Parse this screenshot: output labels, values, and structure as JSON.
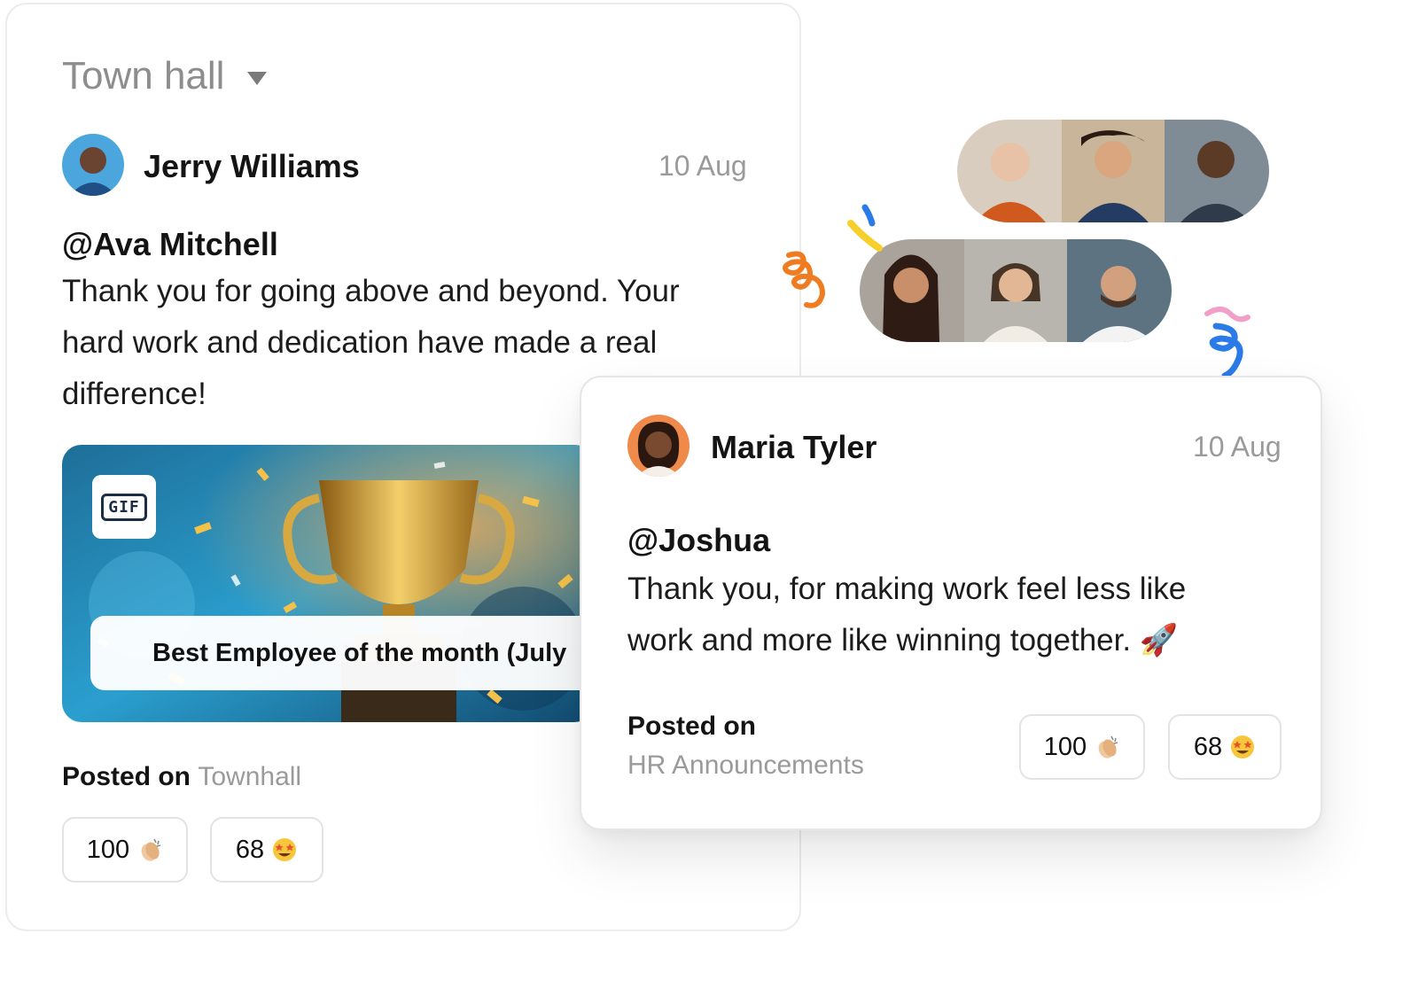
{
  "channel": {
    "name": "Town hall"
  },
  "post_a": {
    "author": "Jerry Williams",
    "date": "10 Aug",
    "mention": "@Ava Mitchell",
    "message_lines": [
      "Thank you for going above and beyond. Your",
      "hard work and dedication have made a real",
      "difference!"
    ],
    "gif_badge": "GIF",
    "banner": "Best Employee of the month (July",
    "posted_on_label": "Posted on",
    "posted_on_channel": "Townhall",
    "reactions": [
      {
        "count": "100",
        "icon": "clapping-hands-icon"
      },
      {
        "count": "68",
        "icon": "star-struck-face-icon"
      }
    ]
  },
  "post_b": {
    "author": "Maria Tyler",
    "date": "10 Aug",
    "mention": "@Joshua",
    "message_lines": [
      "Thank you, for making work feel less like",
      "work and more like winning together. 🚀"
    ],
    "posted_on_label": "Posted on",
    "posted_on_channel": "HR Announcements",
    "reactions": [
      {
        "count": "100",
        "icon": "clapping-hands-icon"
      },
      {
        "count": "68",
        "icon": "star-struck-face-icon"
      }
    ]
  },
  "colors": {
    "accent_orange": "#f07c22",
    "confetti_blue": "#2a7be8",
    "confetti_yellow": "#f6cf2a",
    "confetti_pink": "#f0a0c8"
  }
}
